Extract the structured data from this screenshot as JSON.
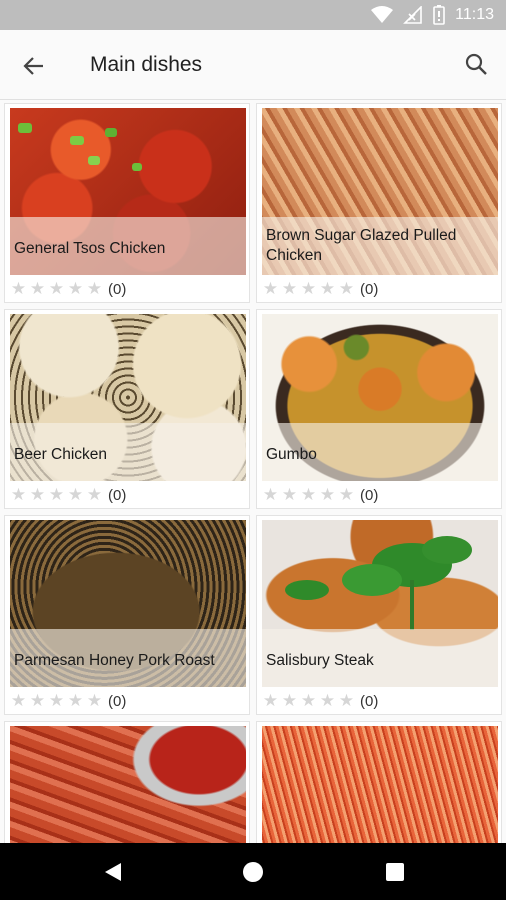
{
  "status_bar": {
    "time": "11:13",
    "icons": [
      "wifi-icon",
      "no-signal-icon",
      "battery-icon"
    ]
  },
  "app_bar": {
    "title": "Main dishes",
    "back_icon": "arrow-left-icon",
    "search_icon": "search-icon"
  },
  "recipes": [
    {
      "name": "General Tsos Chicken",
      "stars_filled": 0,
      "stars_total": 5,
      "count": "(0)"
    },
    {
      "name": "Brown Sugar Glazed Pulled Chicken",
      "stars_filled": 0,
      "stars_total": 5,
      "count": "(0)"
    },
    {
      "name": "Beer Chicken",
      "stars_filled": 0,
      "stars_total": 5,
      "count": "(0)"
    },
    {
      "name": "Gumbo",
      "stars_filled": 0,
      "stars_total": 5,
      "count": "(0)"
    },
    {
      "name": "Parmesan Honey Pork Roast",
      "stars_filled": 0,
      "stars_total": 5,
      "count": "(0)"
    },
    {
      "name": "Salisbury Steak",
      "stars_filled": 0,
      "stars_total": 5,
      "count": "(0)"
    },
    {
      "name": "",
      "stars_filled": 0,
      "stars_total": 5,
      "count": ""
    },
    {
      "name": "",
      "stars_filled": 0,
      "stars_total": 5,
      "count": ""
    }
  ],
  "nav_bar": {
    "icons": [
      "back-triangle-icon",
      "home-circle-icon",
      "recents-square-icon"
    ]
  },
  "colors": {
    "status_bar": "#bdbdbd",
    "app_bar": "#fafafa",
    "nav_bar": "#000000",
    "star_empty": "#d6d6d6"
  }
}
